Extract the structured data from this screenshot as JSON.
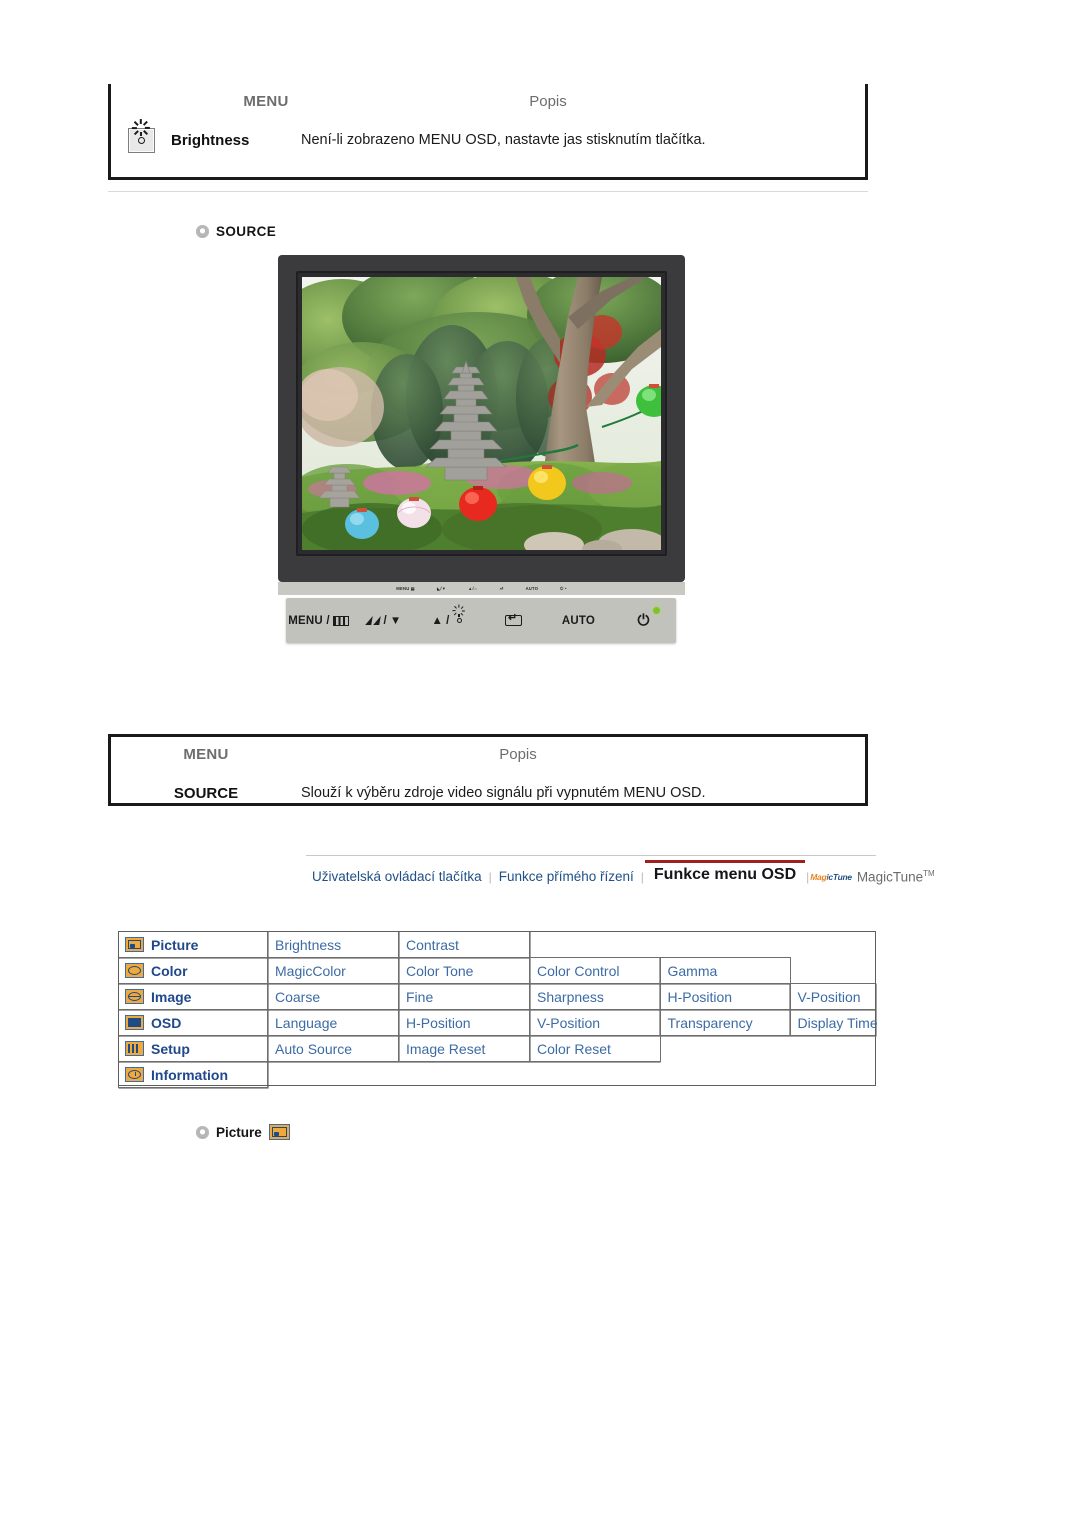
{
  "tables": [
    {
      "id": "brightness-table",
      "header": {
        "menu": "MENU",
        "popis": "Popis"
      },
      "row": {
        "icon": "brightness-sun-icon",
        "label": "Brightness",
        "description": "Není-li zobrazeno MENU OSD, nastavte jas stisknutím tlačítka."
      }
    },
    {
      "id": "source-table",
      "header": {
        "menu": "MENU",
        "popis": "Popis"
      },
      "row": {
        "label": "SOURCE",
        "description": "Slouží k výběru zdroje video signálu při vypnutém MENU OSD."
      }
    }
  ],
  "source_section": {
    "bullet": "bullet-icon",
    "title": "SOURCE"
  },
  "monitor": {
    "mini_labels": [
      "MENU",
      "▼",
      "▲",
      "↵",
      "AUTO",
      "⏻"
    ],
    "buttons": [
      {
        "name": "menu-button",
        "text": "MENU /",
        "icon": "menu-bars-icon"
      },
      {
        "name": "magic-down-button",
        "text": "/",
        "icon": "magicbright-down-icon"
      },
      {
        "name": "up-brightness-button",
        "text": "▲ /",
        "icon": "brightness-sun-icon"
      },
      {
        "name": "enter-button",
        "text": "",
        "icon": "enter-icon"
      },
      {
        "name": "auto-button",
        "text": "AUTO",
        "icon": ""
      },
      {
        "name": "power-button",
        "text": "",
        "icon": "power-icon"
      }
    ],
    "led": "power-led",
    "led_color": "#7fc22a"
  },
  "navbar": {
    "items": [
      {
        "label": "Uživatelská ovládací tlačítka",
        "active": false
      },
      {
        "label": "Funkce přímého řízení",
        "active": false
      },
      {
        "label": "Funkce menu OSD",
        "active": true
      },
      {
        "label": "MagicTune",
        "active": false,
        "tm": "TM",
        "logo": "magictune-logo"
      }
    ],
    "separator": "|",
    "active_underline_color": "#9e2020",
    "link_color": "#1f4f86"
  },
  "osd_menu": {
    "rows": [
      {
        "icon": "picture-icon",
        "category": "Picture",
        "items": [
          "Brightness",
          "Contrast"
        ]
      },
      {
        "icon": "color-icon",
        "category": "Color",
        "items": [
          "MagicColor",
          "Color Tone",
          "Color Control",
          "Gamma"
        ]
      },
      {
        "icon": "image-icon",
        "category": "Image",
        "items": [
          "Coarse",
          "Fine",
          "Sharpness",
          "H-Position",
          "V-Position"
        ]
      },
      {
        "icon": "osd-icon",
        "category": "OSD",
        "items": [
          "Language",
          "H-Position",
          "V-Position",
          "Transparency",
          "Display Time"
        ]
      },
      {
        "icon": "setup-icon",
        "category": "Setup",
        "items": [
          "Auto Source",
          "Image Reset",
          "Color Reset"
        ]
      },
      {
        "icon": "information-icon",
        "category": "Information",
        "items": []
      }
    ],
    "text_color": "#3c6ba5",
    "icon_color": "#f0a93c"
  },
  "picture_section": {
    "bullet": "bullet-icon",
    "title": "Picture",
    "icon": "picture-icon"
  }
}
